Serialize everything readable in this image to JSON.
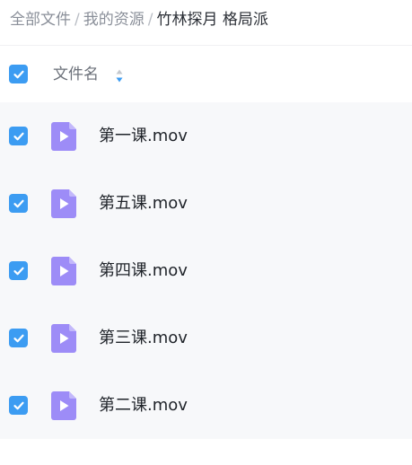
{
  "breadcrumb": {
    "items": [
      "全部文件",
      "我的资源"
    ],
    "separator": "/",
    "current": "竹林探月 格局派"
  },
  "header": {
    "select_all_checked": true,
    "column_label": "文件名"
  },
  "files": [
    {
      "name": "第一课.mov",
      "checked": true,
      "icon": "video-file-icon"
    },
    {
      "name": "第五课.mov",
      "checked": true,
      "icon": "video-file-icon"
    },
    {
      "name": "第四课.mov",
      "checked": true,
      "icon": "video-file-icon"
    },
    {
      "name": "第三课.mov",
      "checked": true,
      "icon": "video-file-icon"
    },
    {
      "name": "第二课.mov",
      "checked": true,
      "icon": "video-file-icon"
    }
  ],
  "colors": {
    "accent": "#3c9cf2",
    "file_icon": "#9d8cf7",
    "list_bg": "#f7f8fa"
  }
}
